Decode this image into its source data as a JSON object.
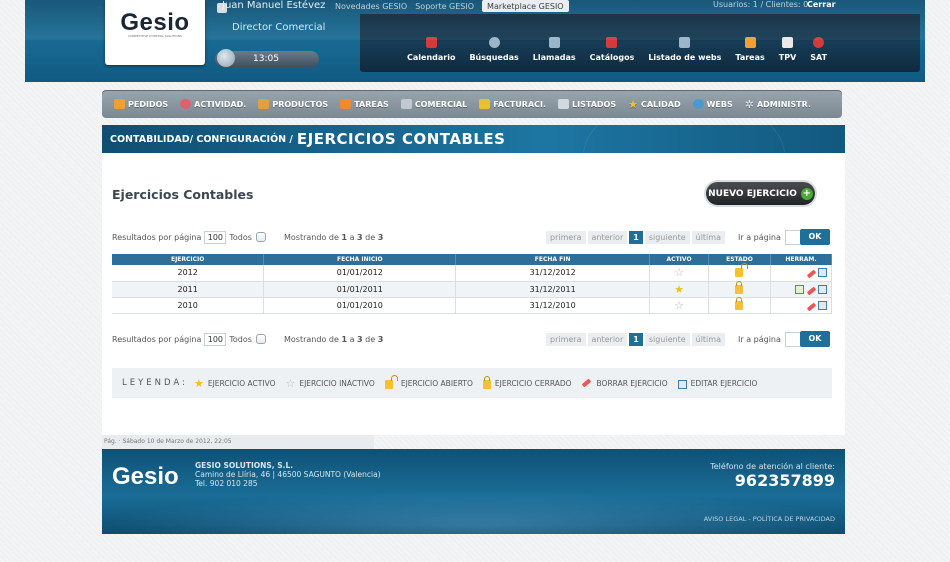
{
  "header": {
    "logo": "Gesio",
    "logo_tag": "COMPETITIVE CONTROL SOLUTIONS",
    "user_name": "Juan Manuel Estévez",
    "user_role": "Director Comercial",
    "clock": "13:05",
    "top_links": [
      "Novedades GESIO",
      "Soporte GESIO",
      "Marketplace GESIO"
    ],
    "users_info": "Usuarios: 1 / Clientes: 0",
    "logout": "Cerrar",
    "quick_nav": [
      {
        "label": "Calendario",
        "icon": "calendar-icon",
        "color": "#d43a3a"
      },
      {
        "label": "Búsquedas",
        "icon": "search-icon",
        "color": "#9ab4c8"
      },
      {
        "label": "Llamadas",
        "icon": "phone-icon",
        "color": "#9ab4c8"
      },
      {
        "label": "Catálogos",
        "icon": "pdf-icon",
        "color": "#d43a3a"
      },
      {
        "label": "Listado de webs",
        "icon": "web-icon",
        "color": "#9ab4c8"
      },
      {
        "label": "Tareas",
        "icon": "tasks-icon",
        "color": "#f0a030"
      },
      {
        "label": "TPV",
        "icon": "tpv-icon",
        "color": "#e8e8e8"
      },
      {
        "label": "SAT",
        "icon": "sat-icon",
        "color": "#d43a3a"
      }
    ]
  },
  "menu": [
    {
      "label": "PEDIDOS",
      "icon": "orders-icon",
      "color": "#f0a030"
    },
    {
      "label": "ACTIVIDAD.",
      "icon": "activity-icon",
      "color": "#e06070"
    },
    {
      "label": "PRODUCTOS",
      "icon": "products-icon",
      "color": "#e0a040"
    },
    {
      "label": "TAREAS",
      "icon": "tasks-icon",
      "color": "#f08a30"
    },
    {
      "label": "COMERCIAL",
      "icon": "handshake-icon",
      "color": "#c0c8d0"
    },
    {
      "label": "FACTURACI.",
      "icon": "billing-icon",
      "color": "#e8c030"
    },
    {
      "label": "LISTADOS",
      "icon": "lists-icon",
      "color": "#d0d8e0"
    },
    {
      "label": "CALIDAD",
      "icon": "star-icon",
      "color": "#f5c327"
    },
    {
      "label": "WEBS",
      "icon": "globe-icon",
      "color": "#4a9ad0"
    },
    {
      "label": "ADMINISTR.",
      "icon": "gear-icon",
      "color": "#d0d8e0"
    }
  ],
  "breadcrumb": {
    "path": "CONTABILIDAD/ CONFIGURACIÓN /",
    "title": "EJERCICIOS CONTABLES"
  },
  "content": {
    "title": "Ejercicios Contables",
    "new_button": "NUEVO EJERCICIO",
    "per_page_label": "Resultados por página",
    "per_page_value": "100",
    "all_label": "Todos",
    "showing_prefix": "Mostrando de",
    "showing_from": "1",
    "showing_mid": "a",
    "showing_to": "3",
    "showing_of": "de",
    "showing_total": "3",
    "pager": {
      "first": "primera",
      "prev": "anterior",
      "current": "1",
      "next": "siguiente",
      "last": "última"
    },
    "goto_label": "Ir a página",
    "ok": "OK",
    "columns": [
      "EJERCICIO",
      "FECHA INICIO",
      "FECHA FIN",
      "ACTIVO",
      "ESTADO",
      "HERRAM."
    ],
    "rows": [
      {
        "ejercicio": "2012",
        "inicio": "01/01/2012",
        "fin": "31/12/2012",
        "activo": false,
        "estado": "abierto"
      },
      {
        "ejercicio": "2011",
        "inicio": "01/01/2011",
        "fin": "31/12/2011",
        "activo": true,
        "estado": "cerrado"
      },
      {
        "ejercicio": "2010",
        "inicio": "01/01/2010",
        "fin": "31/12/2010",
        "activo": false,
        "estado": "cerrado"
      }
    ]
  },
  "legend": {
    "title": "LEYENDA:",
    "items": [
      {
        "label": "EJERCICIO ACTIVO",
        "icon": "star-active-icon"
      },
      {
        "label": "EJERCICIO INACTIVO",
        "icon": "star-inactive-icon"
      },
      {
        "label": "EJERCICIO ABIERTO",
        "icon": "lock-open-icon"
      },
      {
        "label": "EJERCICIO CERRADO",
        "icon": "lock-closed-icon"
      },
      {
        "label": "BORRAR EJERCICIO",
        "icon": "eraser-icon"
      },
      {
        "label": "EDITAR EJERCICIO",
        "icon": "edit-icon"
      }
    ]
  },
  "status": "Pág.  ·  Sábado 10 de Marzo de 2012, 22:05",
  "footer": {
    "logo": "Gesio",
    "company": "GESIO SOLUTIONS, S.L.",
    "address": "Camino de Llíria, 46 | 46500 SAGUNTO (Valencia)",
    "tel": "Tel. 902 010 285",
    "phone_label": "Teléfono de atención al cliente:",
    "phone": "962357899",
    "links": "AVISO LEGAL - POLÍTICA DE PRIVACIDAD"
  }
}
